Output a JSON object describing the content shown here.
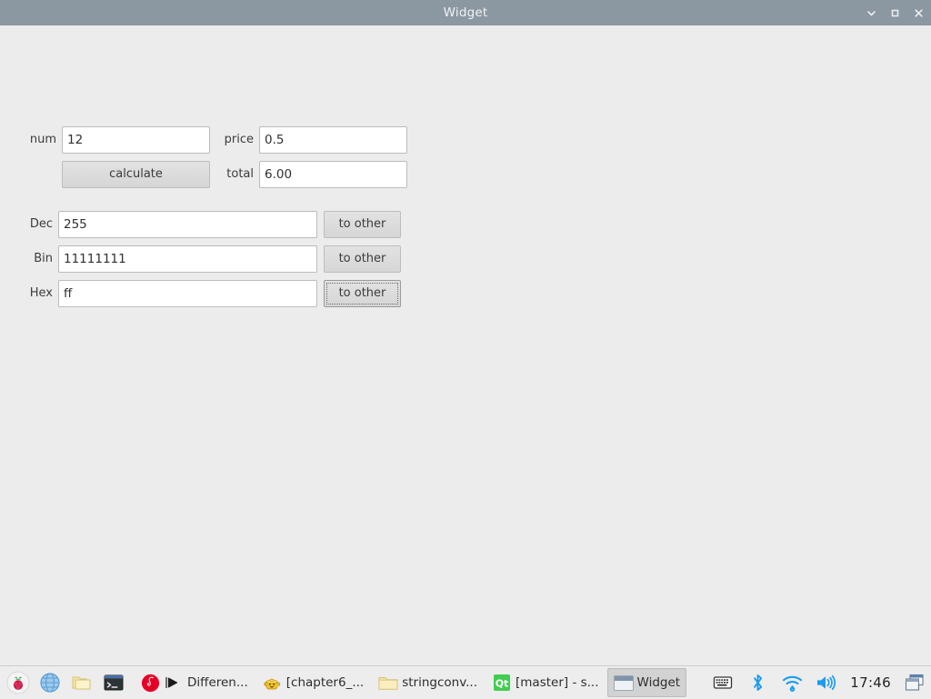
{
  "window": {
    "title": "Widget",
    "controls": [
      {
        "name": "minimize",
        "icon": "chevron-down-icon"
      },
      {
        "name": "maximize",
        "icon": "square-icon"
      },
      {
        "name": "close",
        "icon": "close-icon"
      }
    ]
  },
  "form": {
    "num": {
      "label": "num",
      "value": "12"
    },
    "price": {
      "label": "price",
      "value": "0.5"
    },
    "calculate": {
      "label": "calculate"
    },
    "total": {
      "label": "total",
      "value": "6.00"
    }
  },
  "converter": {
    "rows": [
      {
        "label": "Dec",
        "value": "255",
        "button": "to other",
        "focused": false
      },
      {
        "label": "Bin",
        "value": "11111111",
        "button": "to other",
        "focused": false
      },
      {
        "label": "Hex",
        "value": "ff",
        "button": "to other",
        "focused": true
      }
    ]
  },
  "taskbar": {
    "launchers": [
      {
        "name": "raspberry-pi-menu-icon"
      },
      {
        "name": "web-browser-icon"
      },
      {
        "name": "file-manager-icon"
      },
      {
        "name": "terminal-icon"
      }
    ],
    "tasks": [
      {
        "label": "Differen...",
        "icon": "netease-music-icon",
        "active": false
      },
      {
        "label": "[chapter6_...",
        "icon": "teapot-icon",
        "active": false
      },
      {
        "label": "stringconv...",
        "icon": "folder-icon",
        "active": false
      },
      {
        "label": "[master] - s...",
        "icon": "qt-creator-icon",
        "active": false
      },
      {
        "label": "Widget",
        "icon": "window-icon",
        "active": true
      }
    ],
    "tray": [
      {
        "name": "keyboard-icon"
      },
      {
        "name": "bluetooth-icon"
      },
      {
        "name": "wifi-icon"
      },
      {
        "name": "volume-icon"
      }
    ],
    "clock": "17:46",
    "show_desktop": {
      "name": "window-switcher-icon"
    }
  },
  "colors": {
    "titlebar": "#8b97a1",
    "background": "#ececec",
    "accent": "#2196f3"
  }
}
